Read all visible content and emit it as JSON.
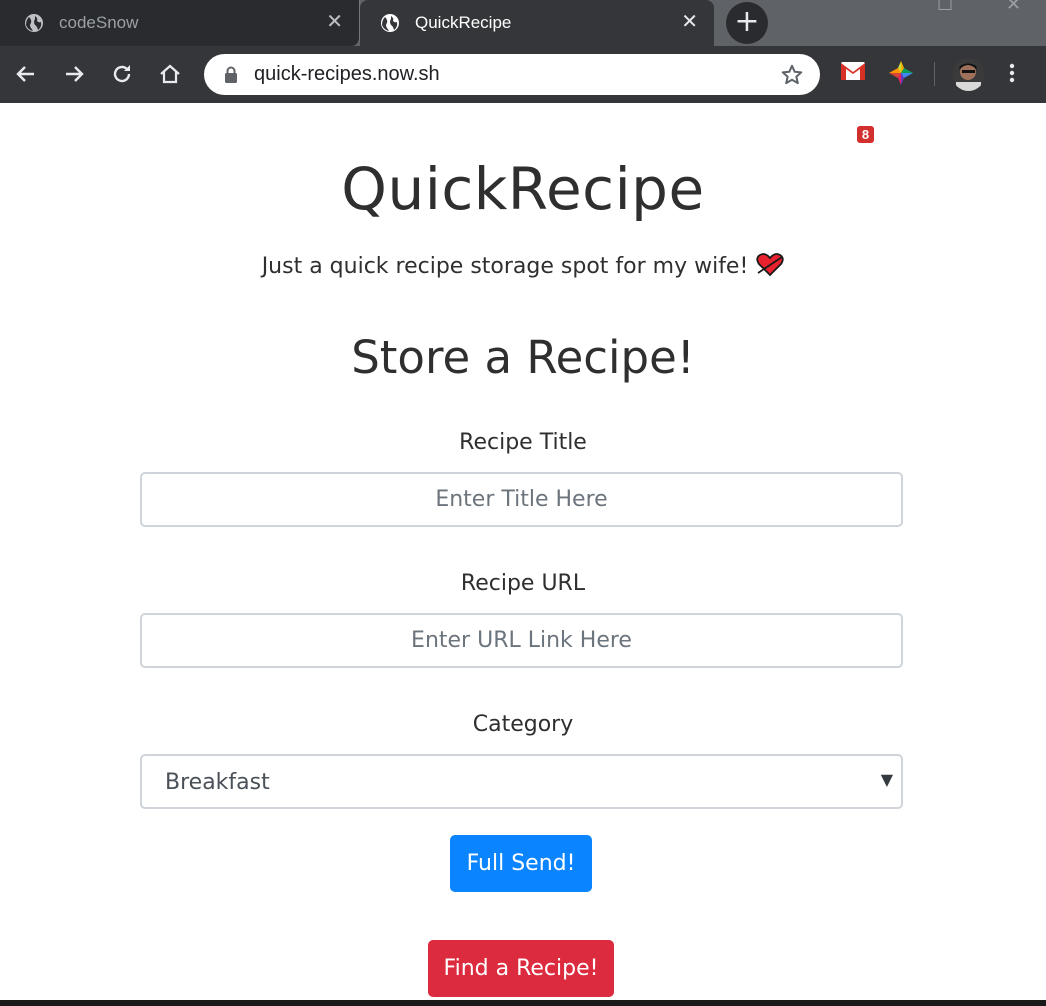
{
  "browser": {
    "tabs": [
      {
        "title": "codeSnow",
        "icon": "globe-icon",
        "active": false
      },
      {
        "title": "QuickRecipe",
        "icon": "globe-icon",
        "active": true
      }
    ],
    "url": "quick-recipes.now.sh",
    "gmail_badge": "8",
    "colors": {
      "tabstrip": "#5f6368",
      "toolbar": "#35363a"
    }
  },
  "page": {
    "site_title": "QuickRecipe",
    "tagline": "Just a quick recipe storage spot for my wife!",
    "form_title": "Store a Recipe!",
    "fields": {
      "title_label": "Recipe Title",
      "title_placeholder": "Enter Title Here",
      "url_label": "Recipe URL",
      "url_placeholder": "Enter URL Link Here",
      "category_label": "Category",
      "category_value": "Breakfast"
    },
    "buttons": {
      "submit": "Full Send!",
      "find": "Find a Recipe!"
    },
    "colors": {
      "primary": "#0a84ff",
      "danger": "#dc2a3f",
      "text": "#2f2f2f"
    }
  }
}
